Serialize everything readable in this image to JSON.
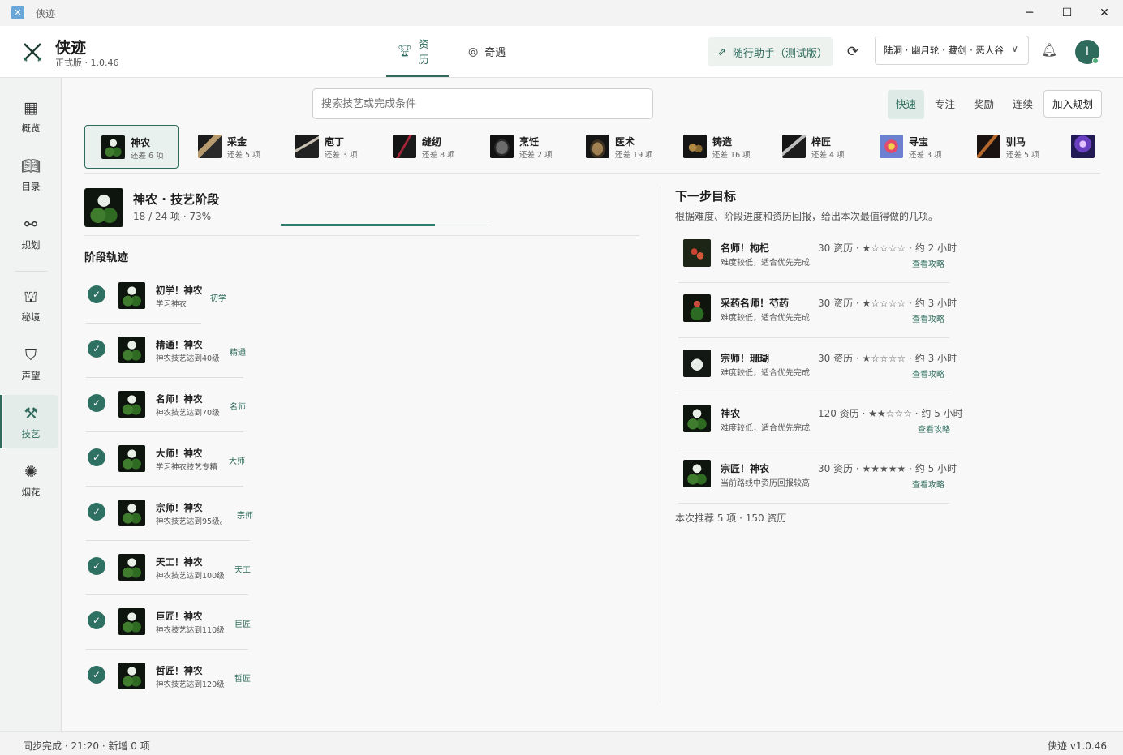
{
  "window": {
    "title": "侠迹",
    "controls": [
      "minimize-icon",
      "maximize-icon",
      "close-icon"
    ]
  },
  "header": {
    "app_name": "侠迹",
    "version": "正式版 · 1.0.46",
    "tabs": [
      {
        "label": "资历",
        "icon": "trophy-icon",
        "active": true
      },
      {
        "label": "奇遇",
        "icon": "compass-icon",
        "active": false
      }
    ],
    "assistant_button": "随行助手（测试版）",
    "character": "陆洞 · 幽月轮 · 藏剑 · 恶人谷",
    "avatar_initial": "I"
  },
  "sidebar": {
    "items": [
      {
        "label": "概览",
        "icon": "grid-icon"
      },
      {
        "label": "目录",
        "icon": "book-icon"
      },
      {
        "label": "规划",
        "icon": "route-icon"
      },
      {
        "label": "秘境",
        "icon": "castle-icon"
      },
      {
        "label": "声望",
        "icon": "badge-icon"
      },
      {
        "label": "技艺",
        "icon": "hammer-icon",
        "active": true
      },
      {
        "label": "烟花",
        "icon": "firework-icon"
      }
    ]
  },
  "search": {
    "placeholder": "搜索技艺或完成条件"
  },
  "modes": [
    {
      "label": "快速",
      "active": true
    },
    {
      "label": "专注"
    },
    {
      "label": "奖励"
    },
    {
      "label": "连续"
    }
  ],
  "plan_button": "加入规划",
  "skills": [
    {
      "name": "神农",
      "remaining": "还差 6 项",
      "active": true
    },
    {
      "name": "采金",
      "remaining": "还差 5 项"
    },
    {
      "name": "庖丁",
      "remaining": "还差 3 项"
    },
    {
      "name": "缝纫",
      "remaining": "还差 8 项"
    },
    {
      "name": "烹饪",
      "remaining": "还差 2 项"
    },
    {
      "name": "医术",
      "remaining": "还差 19 项"
    },
    {
      "name": "铸造",
      "remaining": "还差 16 项"
    },
    {
      "name": "梓匠",
      "remaining": "还差 4 项"
    },
    {
      "name": "寻宝",
      "remaining": "还差 3 项"
    },
    {
      "name": "驯马",
      "remaining": "还差 5 项"
    }
  ],
  "detail": {
    "title": "神农 · 技艺阶段",
    "progress_text": "18 / 24 项 · 73%",
    "progress": 0.73,
    "track_title": "阶段轨迹",
    "stages": [
      {
        "name": "初学！神农",
        "desc": "学习神农",
        "tag": "初学"
      },
      {
        "name": "精通！神农",
        "desc": "神农技艺达到40级",
        "tag": "精通"
      },
      {
        "name": "名师！神农",
        "desc": "神农技艺达到70级",
        "tag": "名师"
      },
      {
        "name": "大师！神农",
        "desc": "学习神农技艺专精",
        "tag": "大师"
      },
      {
        "name": "宗师！神农",
        "desc": "神农技艺达到95级。",
        "tag": "宗师"
      },
      {
        "name": "天工！神农",
        "desc": "神农技艺达到100级",
        "tag": "天工"
      },
      {
        "name": "巨匠！神农",
        "desc": "神农技艺达到110级",
        "tag": "巨匠"
      },
      {
        "name": "哲匠！神农",
        "desc": "神农技艺达到120级",
        "tag": "哲匠"
      }
    ]
  },
  "next": {
    "title": "下一步目标",
    "subtitle": "根据难度、阶段进度和资历回报，给出本次最值得做的几项。",
    "goals": [
      {
        "name": "名师！枸杞",
        "desc": "难度较低，适合优先完成",
        "meta": "30 资历 · ★☆☆☆☆ · 约 2 小时",
        "link": "查看攻略"
      },
      {
        "name": "采药名师！芍药",
        "desc": "难度较低，适合优先完成",
        "meta": "30 资历 · ★☆☆☆☆ · 约 3 小时",
        "link": "查看攻略"
      },
      {
        "name": "宗师！珊瑚",
        "desc": "难度较低，适合优先完成",
        "meta": "30 资历 · ★☆☆☆☆ · 约 3 小时",
        "link": "查看攻略"
      },
      {
        "name": "神农",
        "desc": "难度较低，适合优先完成",
        "meta": "120 资历 · ★★☆☆☆ · 约 5 小时",
        "link": "查看攻略"
      },
      {
        "name": "宗匠！神农",
        "desc": "当前路线中资历回报较高",
        "meta": "30 资历 · ★★★★★ · 约 5 小时",
        "link": "查看攻略"
      }
    ],
    "summary": "本次推荐 5 项 · 150 资历"
  },
  "status": {
    "left": "同步完成 · 21:20 · 新增 0 项",
    "right": "侠迹 v1.0.46"
  }
}
